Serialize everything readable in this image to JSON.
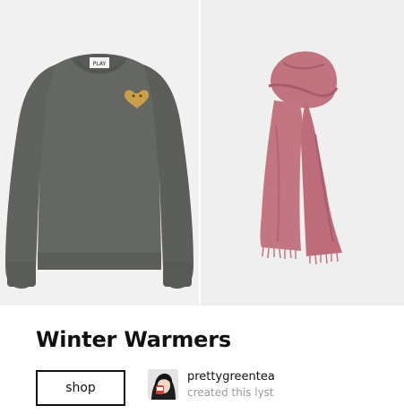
{
  "lyst": {
    "title": "Winter Warmers",
    "shop_label": "shop"
  },
  "products": [
    {
      "name": "grey cardigan with heart logo",
      "icon": "sweater-image",
      "color": "#5d605b"
    },
    {
      "name": "pink scarf",
      "icon": "scarf-image",
      "color": "#c47582"
    }
  ],
  "creator": {
    "username": "prettygreentea",
    "caption": "created this lyst"
  },
  "colors": {
    "text": "#111111",
    "muted": "#9a9a9a",
    "tile_bg": "#f0f0f0"
  }
}
